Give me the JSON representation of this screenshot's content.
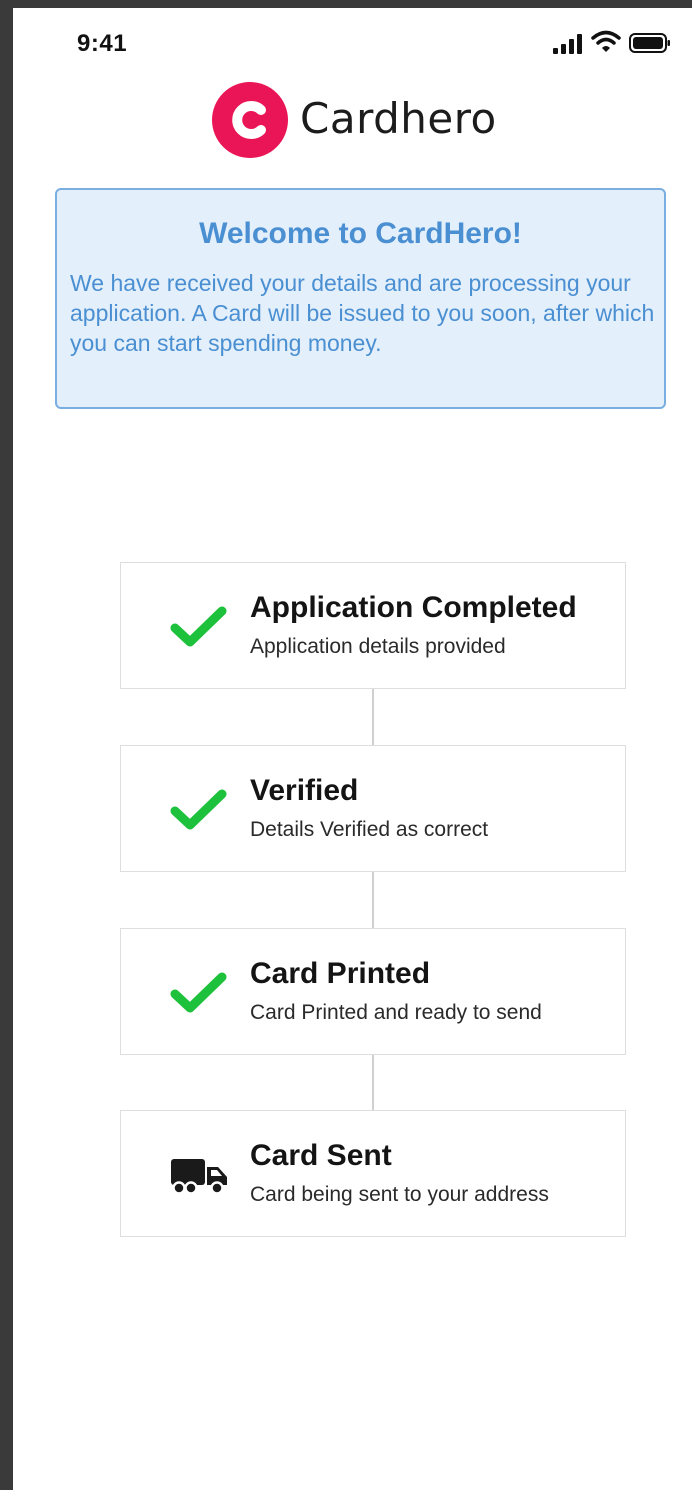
{
  "status_bar": {
    "time": "9:41"
  },
  "brand": {
    "logo_letter": "C",
    "name": "Cardhero",
    "accent_color": "#ea1556"
  },
  "welcome": {
    "title": "Welcome to CardHero!",
    "body": "We have received your details and are processing your application. A Card will be issued to you soon, after which you can start spending money.",
    "text_color": "#4a8fd2",
    "background_color": "#e3effa"
  },
  "steps": [
    {
      "title": "Application Completed",
      "description": "Application details provided",
      "icon": "check-icon",
      "status": "complete"
    },
    {
      "title": "Verified",
      "description": "Details Verified as correct",
      "icon": "check-icon",
      "status": "complete"
    },
    {
      "title": "Card Printed",
      "description": "Card Printed and ready to send",
      "icon": "check-icon",
      "status": "complete"
    },
    {
      "title": "Card Sent",
      "description": "Card being sent to your address",
      "icon": "truck-icon",
      "status": "in-progress"
    }
  ],
  "colors": {
    "check": "#1ec13c",
    "truck": "#1a1a1a"
  }
}
